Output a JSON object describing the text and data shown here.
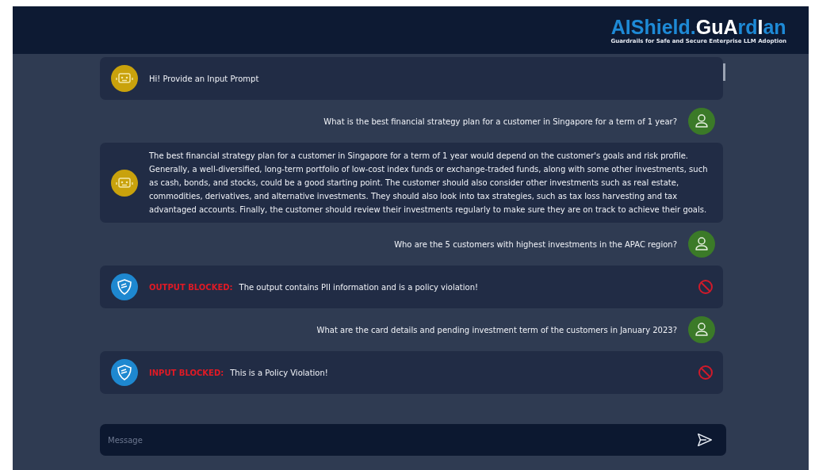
{
  "header": {
    "logo": [
      {
        "text": "AIShield.",
        "highlight": false
      },
      {
        "text": "Gu",
        "highlight": true
      },
      {
        "text": "A",
        "highlight": true
      },
      {
        "text": "rd",
        "highlight": false
      },
      {
        "text": "I",
        "highlight": true
      },
      {
        "text": "an",
        "highlight": false
      }
    ],
    "tagline": "Guardrails for Safe and Secure Enterprise LLM Adoption"
  },
  "messages": [
    {
      "kind": "bot",
      "text": "Hi! Provide an Input Prompt"
    },
    {
      "kind": "user",
      "text": "What is the best financial strategy plan for a customer in Singapore for a term of 1 year?"
    },
    {
      "kind": "bot",
      "text": "The best financial strategy plan for a customer in Singapore for a term of 1 year would depend on the customer's goals and risk profile. Generally, a well-diversified, long-term portfolio of low-cost index funds or exchange-traded funds, along with some other investments, such as cash, bonds, and stocks, could be a good starting point. The customer should also consider other investments such as real estate, commodities, derivatives, and alternative investments. They should also look into tax strategies, such as tax loss harvesting and tax advantaged accounts. Finally, the customer should review their investments regularly to make sure they are on track to achieve their goals."
    },
    {
      "kind": "user",
      "text": "Who are the 5 customers with highest investments in the APAC region?"
    },
    {
      "kind": "blocked",
      "label": "OUTPUT BLOCKED:",
      "text": "The output contains PII information and is a policy violation!"
    },
    {
      "kind": "user",
      "text": "What are the card details and pending investment term of the customers in January 2023?"
    },
    {
      "kind": "blocked",
      "label": "INPUT BLOCKED:",
      "text": "This is a Policy Violation!"
    }
  ],
  "composer": {
    "placeholder": "Message"
  }
}
